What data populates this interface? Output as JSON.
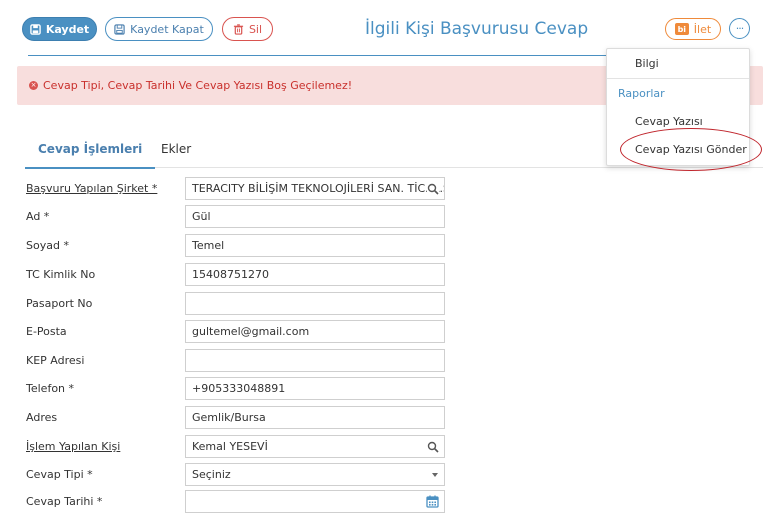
{
  "toolbar": {
    "save_label": "Kaydet",
    "save_close_label": "Kaydet Kapat",
    "delete_label": "Sil",
    "forward_label": "İlet",
    "forward_icon_text": "bi",
    "more_label": "···"
  },
  "page_title": "İlgili Kişi Başvurusu Cevap",
  "alert": {
    "icon": "×",
    "message": "Cevap Tipi, Cevap Tarihi Ve Cevap Yazısı Boş Geçilemez!"
  },
  "menu": {
    "bilgi": "Bilgi",
    "reports_header": "Raporlar",
    "cevap_yazisi": "Cevap Yazısı",
    "cevap_yazisi_gonder": "Cevap Yazısı Gönder"
  },
  "tabs": [
    {
      "label": "Cevap İşlemleri"
    },
    {
      "label": "Ekler"
    }
  ],
  "form": {
    "company": {
      "label": "Başvuru Yapılan Şirket *",
      "value": "TERACITY BİLİŞİM TEKNOLOJİLERİ SAN. TİC. A.Ş."
    },
    "ad": {
      "label": "Ad *",
      "value": "Gül"
    },
    "soyad": {
      "label": "Soyad *",
      "value": "Temel"
    },
    "tc": {
      "label": "TC Kimlik No",
      "value": "15408751270"
    },
    "pasaport": {
      "label": "Pasaport No",
      "value": ""
    },
    "eposta": {
      "label": "E-Posta",
      "value": "gultemel@gmail.com"
    },
    "kep": {
      "label": "KEP Adresi",
      "value": ""
    },
    "telefon": {
      "label": "Telefon *",
      "value": "+905333048891"
    },
    "adres": {
      "label": "Adres",
      "value": "Gemlik/Bursa"
    },
    "islem_kisi": {
      "label": "İşlem Yapılan Kişi",
      "value": "Kemal YESEVİ"
    },
    "cevap_tipi": {
      "label": "Cevap Tipi *",
      "value": "Seçiniz"
    },
    "cevap_tarihi": {
      "label": "Cevap Tarihi *",
      "value": ""
    }
  },
  "colors": {
    "primary": "#4a90c2",
    "danger": "#d9534f",
    "warning": "#ef8a3a",
    "alert_bg": "#f8dedd"
  }
}
